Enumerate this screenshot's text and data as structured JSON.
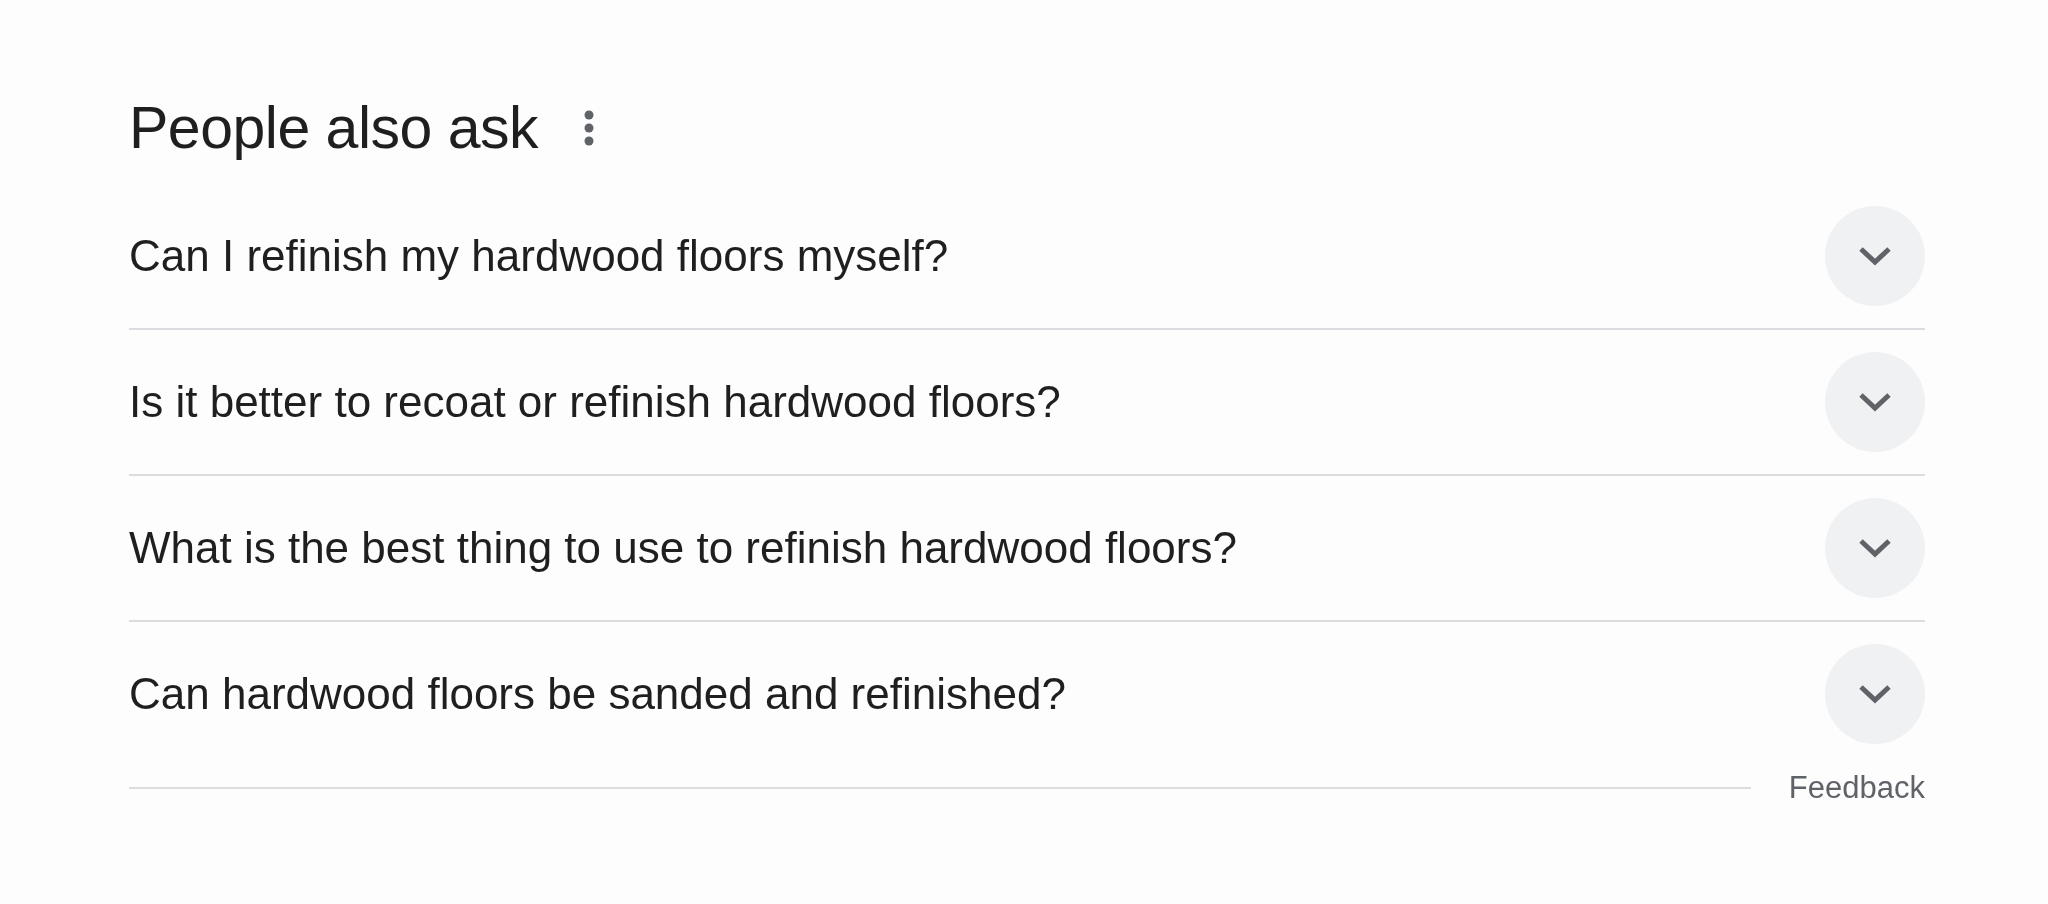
{
  "heading": "People also ask",
  "questions": [
    {
      "text": "Can I refinish my hardwood floors myself?",
      "expanded": false
    },
    {
      "text": "Is it better to recoat or refinish hardwood floors?",
      "expanded": false
    },
    {
      "text": "What is the best thing to use to refinish hardwood floors?",
      "expanded": false
    },
    {
      "text": "Can hardwood floors be sanded and refinished?",
      "expanded": false
    }
  ],
  "feedback": "Feedback"
}
